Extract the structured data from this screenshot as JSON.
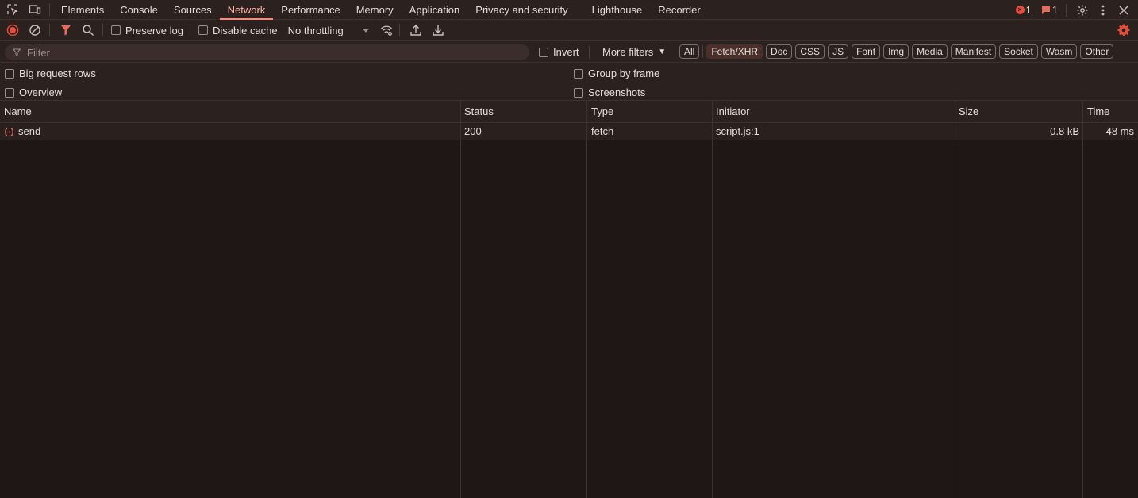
{
  "tabs": [
    "Elements",
    "Console",
    "Sources",
    "Network",
    "Performance",
    "Memory",
    "Application",
    "Privacy and security",
    "Lighthouse",
    "Recorder"
  ],
  "active_tab": "Network",
  "badges": {
    "errors": "1",
    "messages": "1"
  },
  "toolbar": {
    "preserve_log": "Preserve log",
    "disable_cache": "Disable cache",
    "throttling": "No throttling"
  },
  "filter": {
    "placeholder": "Filter",
    "invert": "Invert",
    "more_filters": "More filters",
    "chips": [
      "All",
      "Fetch/XHR",
      "Doc",
      "CSS",
      "JS",
      "Font",
      "Img",
      "Media",
      "Manifest",
      "Socket",
      "Wasm",
      "Other"
    ],
    "selected_chip": "Fetch/XHR"
  },
  "options": {
    "big_request_rows": "Big request rows",
    "overview": "Overview",
    "group_by_frame": "Group by frame",
    "screenshots": "Screenshots"
  },
  "table": {
    "columns": [
      "Name",
      "Status",
      "Type",
      "Initiator",
      "Size",
      "Time"
    ],
    "rows": [
      {
        "name": "send",
        "status": "200",
        "type": "fetch",
        "initiator": "script.js:1",
        "size": "0.8 kB",
        "time": "48 ms"
      }
    ]
  },
  "colors": {
    "accent": "#ff8a7a",
    "record": "#e84b3c"
  }
}
